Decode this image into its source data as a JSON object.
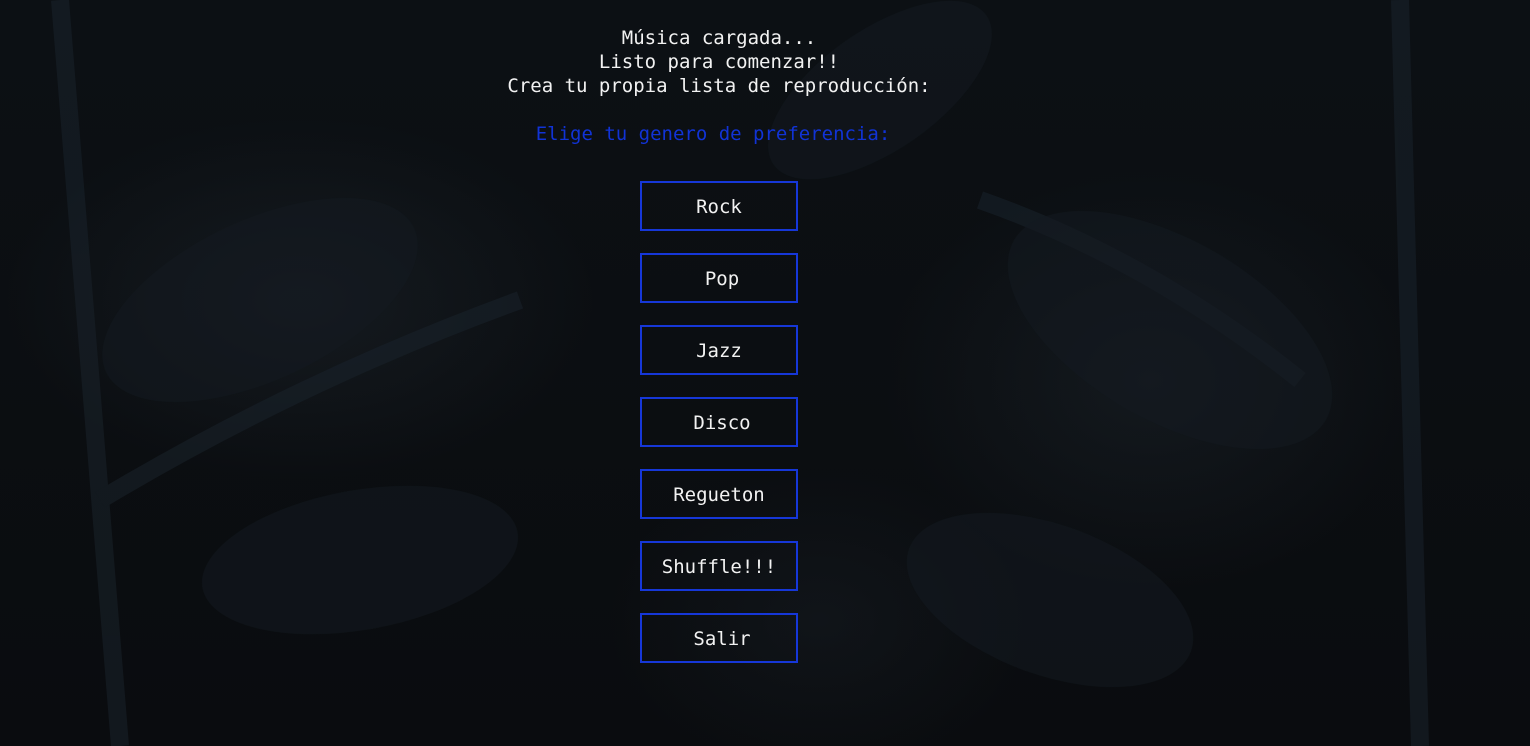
{
  "intro": {
    "line1": "Música cargada...",
    "line2": "Listo para comenzar!!",
    "line3": "Crea tu propia lista de reproducción:"
  },
  "prompt": "Elige tu genero de preferencia:",
  "menu": {
    "buttons": [
      {
        "label": "Rock"
      },
      {
        "label": "Pop"
      },
      {
        "label": "Jazz"
      },
      {
        "label": "Disco"
      },
      {
        "label": "Regueton"
      },
      {
        "label": "Shuffle!!!"
      },
      {
        "label": "Salir"
      }
    ]
  },
  "colors": {
    "background": "#0b0d10",
    "text": "#f2f2f2",
    "accent": "#1637d8"
  }
}
